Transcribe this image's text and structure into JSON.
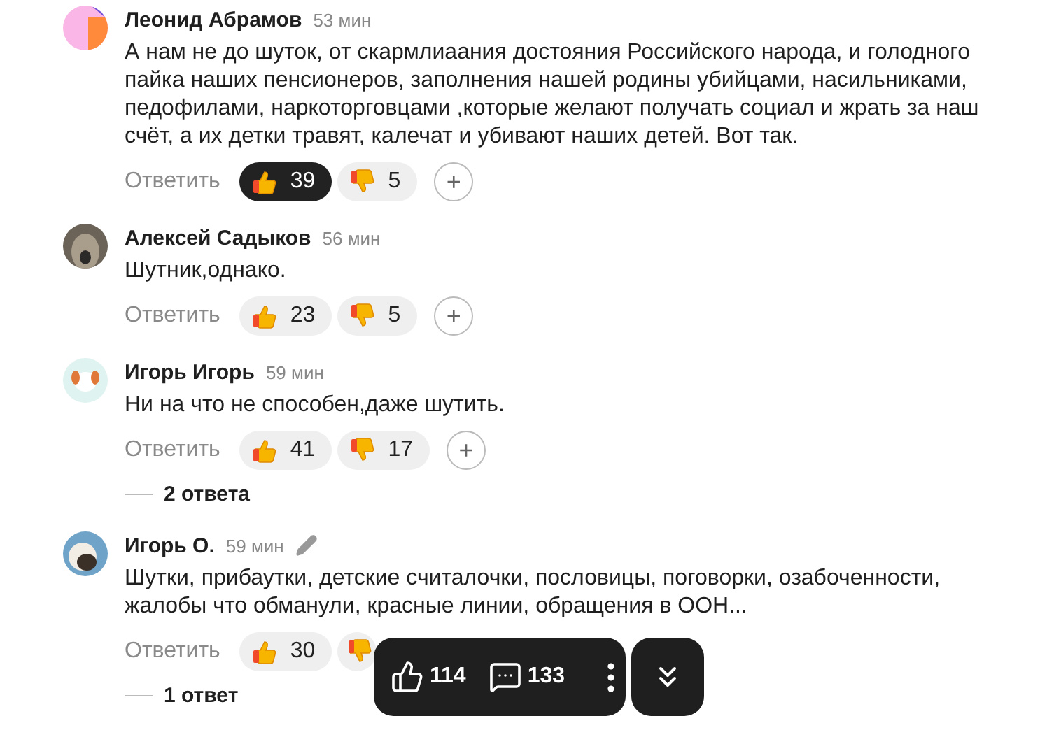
{
  "comments": [
    {
      "author": "Леонид Абрамов",
      "time": "53 мин",
      "edited": false,
      "text": "А нам не до шуток, от скармлиаания достояния Российского народа, и голодного пайка наших пенсионеров, заполнения нашей родины убийцами, насильниками, педофилами, наркоторговцами ,которые желают получать социал и жрать за наш счёт, а их детки травят, калечат и убивают наших детей. Вот так.",
      "reply": "Ответить",
      "like": {
        "count": "39",
        "selected": true
      },
      "dislike": {
        "count": "5",
        "selected": false
      },
      "add": "+"
    },
    {
      "author": "Алексей Садыков",
      "time": "56 мин",
      "edited": false,
      "text": "Шутник,однако.",
      "reply": "Ответить",
      "like": {
        "count": "23",
        "selected": false
      },
      "dislike": {
        "count": "5",
        "selected": false
      },
      "add": "+"
    },
    {
      "author": "Игорь Игорь",
      "time": "59 мин",
      "edited": false,
      "text": "Ни на что не способен,даже шутить.",
      "reply": "Ответить",
      "like": {
        "count": "41",
        "selected": false
      },
      "dislike": {
        "count": "17",
        "selected": false
      },
      "add": "+",
      "replies": "2 ответа"
    },
    {
      "author": "Игорь О.",
      "time": "59 мин",
      "edited": true,
      "text": "Шутки, прибаутки, детские считалочки, пословицы, поговорки, озабоченности, жалобы что обманули, красные линии, обращения в ООН...",
      "reply": "Ответить",
      "like": {
        "count": "30",
        "selected": false
      },
      "dislike": {
        "selected": false
      },
      "replies": "1 ответ"
    }
  ],
  "float_bar": {
    "likes": "114",
    "comments": "133"
  }
}
